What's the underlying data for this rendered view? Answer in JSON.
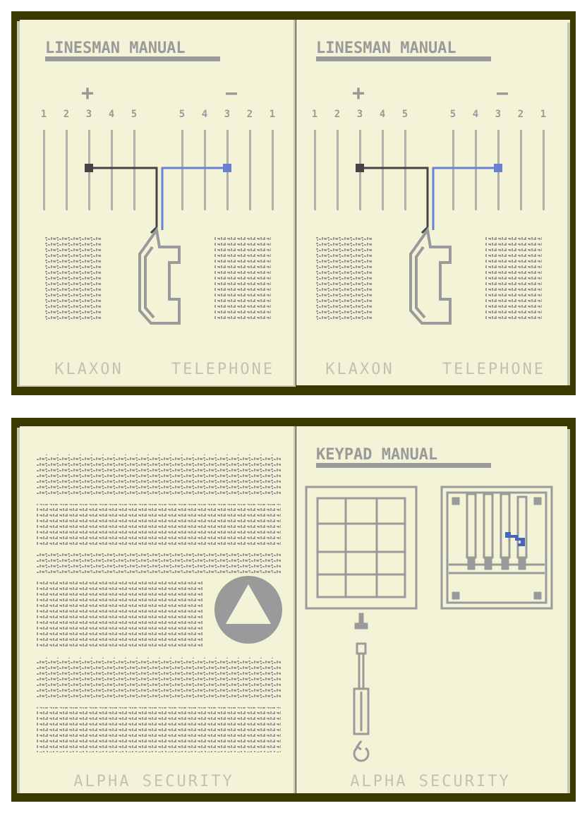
{
  "colors": {
    "frame": "#3a3a00",
    "page": "#f3f3d8",
    "ink": "#9a9a9a",
    "wire_black": "#444444",
    "wire_blue": "#6b80d0",
    "arrow": "#4466bb"
  },
  "linesman_left": {
    "title": "LINESMAN MANUAL",
    "plus": "+",
    "minus": "−",
    "labels_plus": [
      "1",
      "2",
      "3",
      "4",
      "5"
    ],
    "labels_minus": [
      "5",
      "4",
      "3",
      "2",
      "1"
    ],
    "footer_left": "KLAXON",
    "footer_right": "TELEPHONE",
    "phone_icon": "telephone-handset-icon"
  },
  "linesman_right": {
    "title": "LINESMAN MANUAL",
    "plus": "+",
    "minus": "−",
    "labels_plus": [
      "1",
      "2",
      "3",
      "4",
      "5"
    ],
    "labels_minus": [
      "5",
      "4",
      "3",
      "2",
      "1"
    ],
    "footer_left": "KLAXON",
    "footer_right": "TELEPHONE",
    "phone_icon": "telephone-handset-icon"
  },
  "security_left": {
    "footer": "ALPHA SECURITY",
    "emblem_icon": "triangle-in-circle-icon"
  },
  "keypad_right": {
    "title": "KEYPAD MANUAL",
    "footer": "ALPHA SECURITY",
    "keypad_icon": "keypad-grid-icon",
    "panel_icon": "circuit-panel-icon",
    "tool_icon": "screwdriver-icon"
  }
}
